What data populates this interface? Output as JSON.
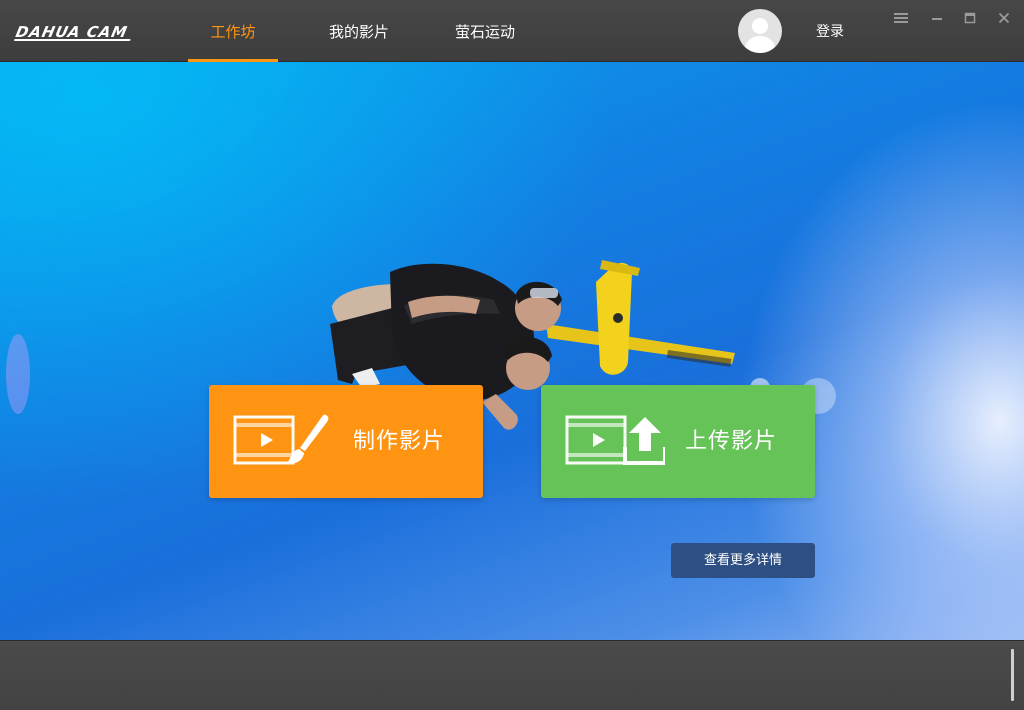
{
  "app": {
    "logo_text": "DAHUA CAM"
  },
  "tabs": [
    {
      "label": "工作坊",
      "active": true
    },
    {
      "label": "我的影片",
      "active": false
    },
    {
      "label": "萤石运动",
      "active": false
    }
  ],
  "account": {
    "login_label": "登录"
  },
  "window_controls": [
    "menu-icon",
    "minimize-icon",
    "maximize-icon",
    "close-icon"
  ],
  "hero": {
    "make_video_label": "制作影片",
    "upload_video_label": "上传影片",
    "more_details_label": "查看更多详情"
  },
  "colors": {
    "accent": "#ff9612",
    "make_button": "#ff9412",
    "upload_button": "#66c357",
    "more_button": "#2d4f84"
  }
}
